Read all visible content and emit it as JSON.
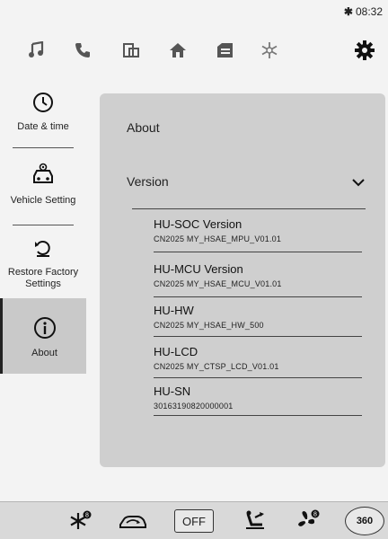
{
  "status": {
    "time": "08:32",
    "bluetooth_glyph": "✱"
  },
  "topnav": {
    "icons": [
      "music-icon",
      "phone-icon",
      "screen-mirror-icon",
      "home-icon",
      "vehicle-card-icon",
      "climate-icon",
      "settings-gear-icon"
    ],
    "active": "settings-gear-icon"
  },
  "sidebar": {
    "items": [
      {
        "label": "Date & time",
        "icon": "clock-icon"
      },
      {
        "label": "Vehicle Setting",
        "icon": "car-gear-icon"
      },
      {
        "label": "Restore Factory Settings",
        "icon": "restore-icon"
      },
      {
        "label": "About",
        "icon": "info-icon",
        "active": true
      }
    ]
  },
  "main": {
    "title": "About",
    "version_label": "Version",
    "versions": [
      {
        "name": "HU-SOC Version",
        "value": "CN2025 MY_HSAE_MPU_V01.01"
      },
      {
        "name": "HU-MCU Version",
        "value": "CN2025 MY_HSAE_MCU_V01.01"
      },
      {
        "name": "HU-HW",
        "value": "CN2025 MY_HSAE_HW_500"
      },
      {
        "name": "HU-LCD",
        "value": "CN2025 MY_CTSP_LCD_V01.01"
      },
      {
        "name": "HU-SN",
        "value": "30163190820000001"
      }
    ]
  },
  "bottombar": {
    "off_label": "OFF",
    "label_360": "360",
    "icons": [
      "defrost-icon",
      "car-recirculation-icon",
      "off-button",
      "seat-airflow-icon",
      "fan-icon",
      "camera-360-button"
    ]
  },
  "colors": {
    "panel": "#cfcfcf",
    "background": "#f3f3f3",
    "active_item": "#c9c9c9"
  }
}
